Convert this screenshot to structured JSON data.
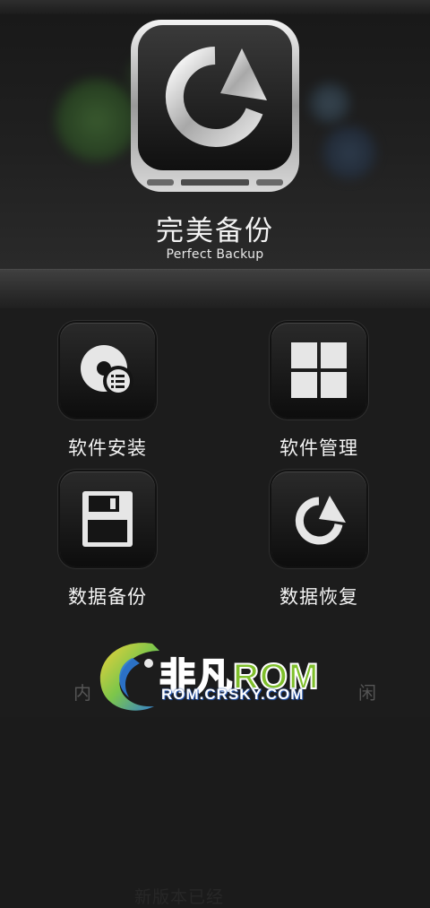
{
  "app": {
    "title": "完美备份",
    "subtitle": "Perfect Backup",
    "icon": "refresh-arrow-icon"
  },
  "menu": {
    "items": [
      {
        "label": "软件安装",
        "icon": "disc-install-icon"
      },
      {
        "label": "软件管理",
        "icon": "grid-manage-icon"
      },
      {
        "label": "数据备份",
        "icon": "floppy-save-icon"
      },
      {
        "label": "数据恢复",
        "icon": "restore-arrow-icon"
      }
    ]
  },
  "background_notice": {
    "partial_text": "新版本已经",
    "bottom_left": "内",
    "bottom_right": "闲"
  },
  "watermark": {
    "brand_cn": "非凡",
    "brand_rom": "ROM",
    "url": "ROM.CRSKY.COM"
  },
  "colors": {
    "background": "#1b1b1b",
    "tile": "#111111",
    "watermark_blue": "#3b6fd9",
    "watermark_green": "#7fbf2b"
  }
}
